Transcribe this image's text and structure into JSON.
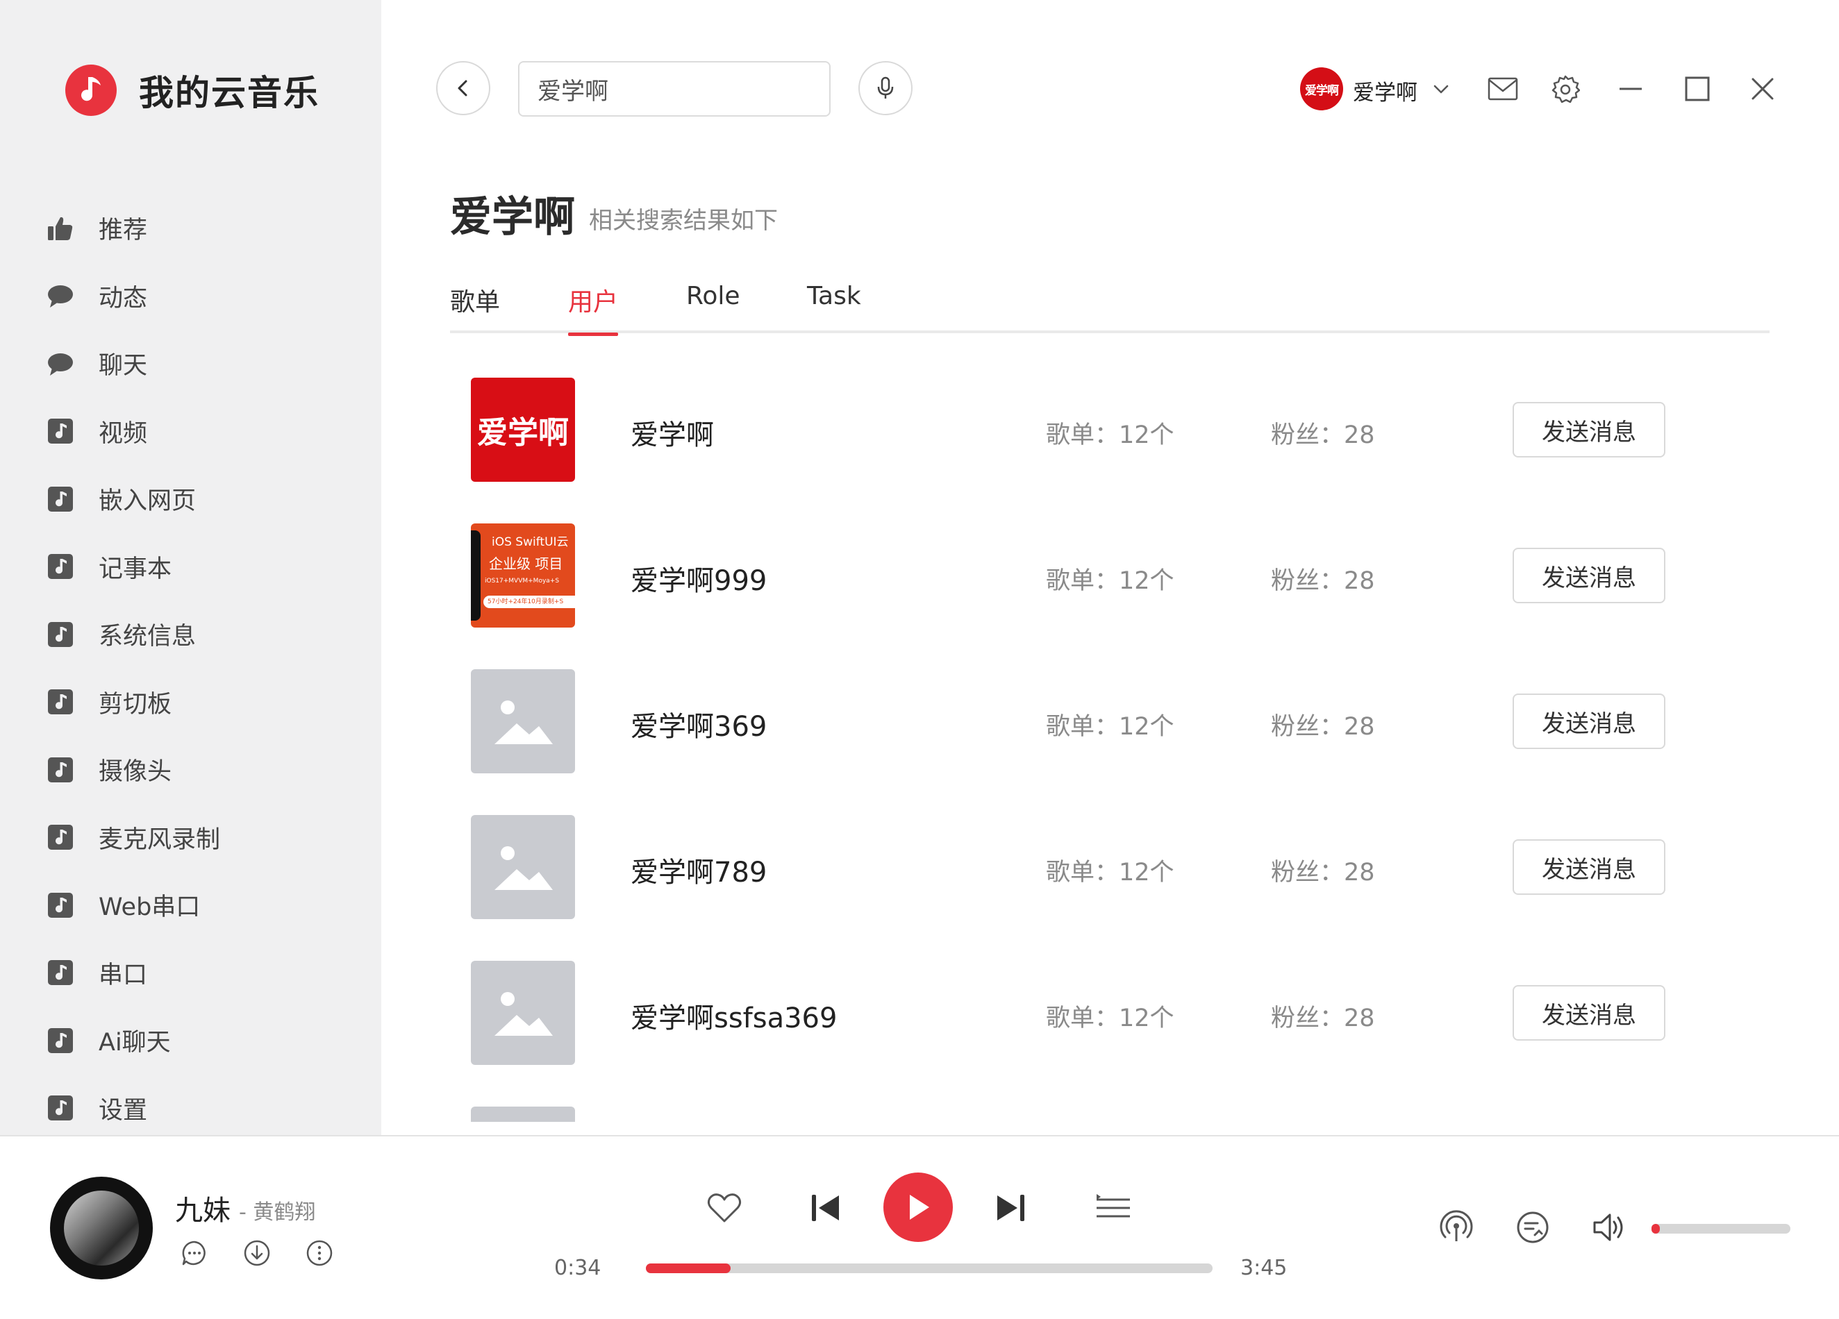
{
  "app": {
    "title": "我的云音乐",
    "accent": "#e8333e"
  },
  "sidebar": {
    "items": [
      {
        "label": "推荐",
        "icon": "thumbs-up-icon"
      },
      {
        "label": "动态",
        "icon": "chat-bubble-icon"
      },
      {
        "label": "聊天",
        "icon": "chat-bubble-icon"
      },
      {
        "label": "视频",
        "icon": "music-note-icon"
      },
      {
        "label": "嵌入网页",
        "icon": "music-note-icon"
      },
      {
        "label": "记事本",
        "icon": "music-note-icon"
      },
      {
        "label": "系统信息",
        "icon": "music-note-icon"
      },
      {
        "label": "剪切板",
        "icon": "music-note-icon"
      },
      {
        "label": "摄像头",
        "icon": "music-note-icon"
      },
      {
        "label": "麦克风录制",
        "icon": "music-note-icon"
      },
      {
        "label": "Web串口",
        "icon": "music-note-icon"
      },
      {
        "label": "串口",
        "icon": "music-note-icon"
      },
      {
        "label": "Ai聊天",
        "icon": "music-note-icon"
      },
      {
        "label": "设置",
        "icon": "music-note-icon"
      }
    ]
  },
  "topbar": {
    "search_value": "爱学啊",
    "user": {
      "avatar_text": "爱学啊",
      "name": "爱学啊"
    }
  },
  "search_result": {
    "title": "爱学啊",
    "subtitle": "相关搜索结果如下",
    "tabs": [
      {
        "label": "歌单",
        "active": false
      },
      {
        "label": "用户",
        "active": true
      },
      {
        "label": "Role",
        "active": false
      },
      {
        "label": "Task",
        "active": false
      }
    ],
    "rows": [
      {
        "name": "爱学啊",
        "playlists": "歌单：12个",
        "fans": "粉丝：28",
        "button": "发送消息",
        "avatar": "red-logo",
        "avatar_text": "爱学啊"
      },
      {
        "name": "爱学啊999",
        "playlists": "歌单：12个",
        "fans": "粉丝：28",
        "button": "发送消息",
        "avatar": "promo",
        "avatar_lines": [
          "iOS SwiftUI云",
          "企业级 项目",
          "iOS17+MVVM+Moya+S",
          "57小时+24年10月录制+S"
        ]
      },
      {
        "name": "爱学啊369",
        "playlists": "歌单：12个",
        "fans": "粉丝：28",
        "button": "发送消息",
        "avatar": "placeholder"
      },
      {
        "name": "爱学啊789",
        "playlists": "歌单：12个",
        "fans": "粉丝：28",
        "button": "发送消息",
        "avatar": "placeholder"
      },
      {
        "name": "爱学啊ssfsa369",
        "playlists": "歌单：12个",
        "fans": "粉丝：28",
        "button": "发送消息",
        "avatar": "placeholder"
      }
    ]
  },
  "player": {
    "song": "九妹",
    "artist": "- 黄鹤翔",
    "current_time": "0:34",
    "total_time": "3:45",
    "progress_fraction": 0.15,
    "volume_fraction": 0.06
  }
}
